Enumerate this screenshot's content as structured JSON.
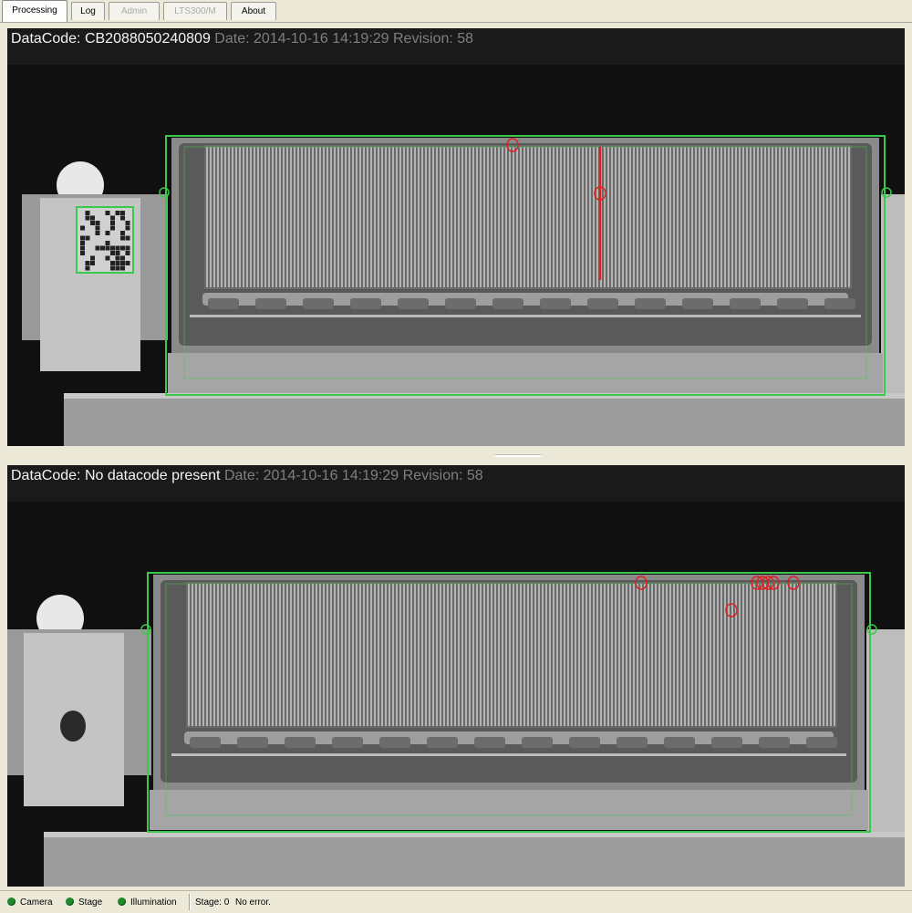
{
  "tabs": [
    {
      "label": "Processing",
      "state": "active"
    },
    {
      "label": "Log",
      "state": "normal"
    },
    {
      "label": "Admin",
      "state": "disabled"
    },
    {
      "label": "LTS300/M",
      "state": "disabled"
    },
    {
      "label": "About",
      "state": "normal"
    }
  ],
  "panels": [
    {
      "datacode_text": "DataCode: CB2088050240809",
      "meta_text": "Date: 2014-10-16 14:19:29 Revision: 58",
      "has_datamatrix": true,
      "defect_markers": 2,
      "defect_line": true
    },
    {
      "datacode_text": "DataCode: No datacode present",
      "meta_text": "Date: 2014-10-16 14:19:29 Revision: 58",
      "has_datamatrix": false,
      "defect_markers": 7,
      "defect_line": false
    }
  ],
  "status": {
    "indicators": [
      {
        "label": "Camera",
        "color": "#1f8a2c"
      },
      {
        "label": "Stage",
        "color": "#1f8a2c"
      },
      {
        "label": "Illumination",
        "color": "#1f8a2c"
      }
    ],
    "stage_label": "Stage: 0",
    "message": "No error."
  },
  "colors": {
    "roi_outline": "#3cc84a",
    "defect_marker": "#e02020"
  }
}
